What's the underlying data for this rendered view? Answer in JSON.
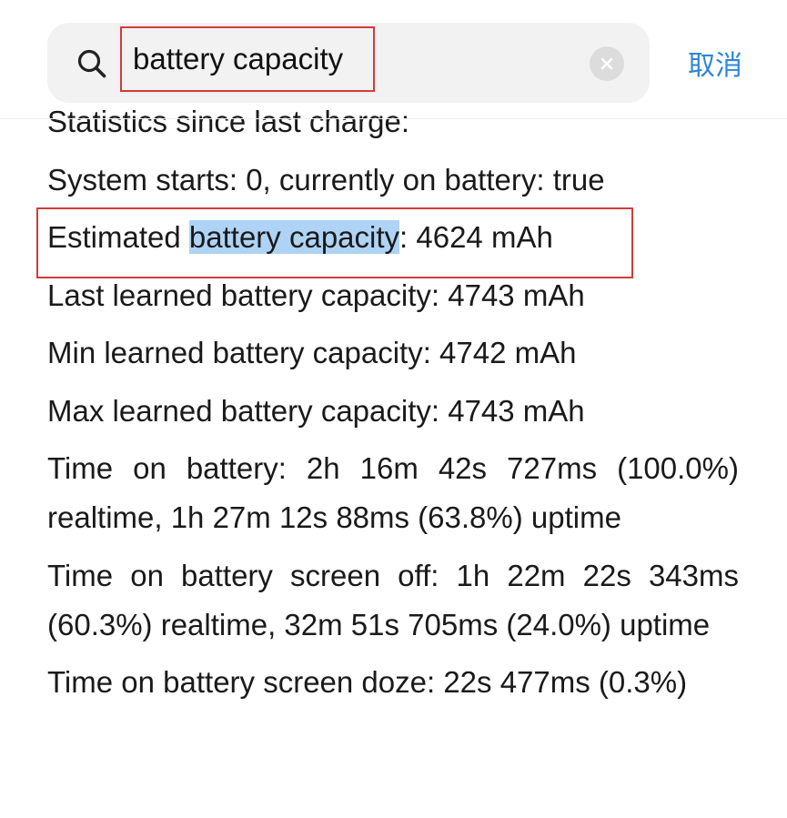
{
  "search": {
    "query": "battery capacity",
    "cancel_label": "取消"
  },
  "result_lines": {
    "line1": "Statistics since last charge:",
    "line2": "System starts: 0, currently on battery: true",
    "line3_prefix": "Estimated ",
    "line3_highlight": "battery capacity",
    "line3_suffix": ": 4624 mAh",
    "line4": "Last learned battery capacity: 4743 mAh",
    "line5": "Min learned battery capacity: 4742 mAh",
    "line6": "Max learned battery capacity: 4743 mAh",
    "line7": "Time on battery: 2h 16m 42s 727ms (100.0%) realtime, 1h 27m 12s 88ms (63.8%) uptime",
    "line8": "Time on battery screen off: 1h 22m 22s 343ms (60.3%) realtime, 32m 51s 705ms (24.0%) uptime",
    "line9": "Time on battery screen doze: 22s 477ms (0.3%)"
  },
  "colors": {
    "highlight": "#aed3f5",
    "annotation_box": "#d23b3b",
    "cancel_text": "#2f86d8"
  },
  "icons": {
    "search": "search-icon",
    "clear": "clear-icon"
  }
}
